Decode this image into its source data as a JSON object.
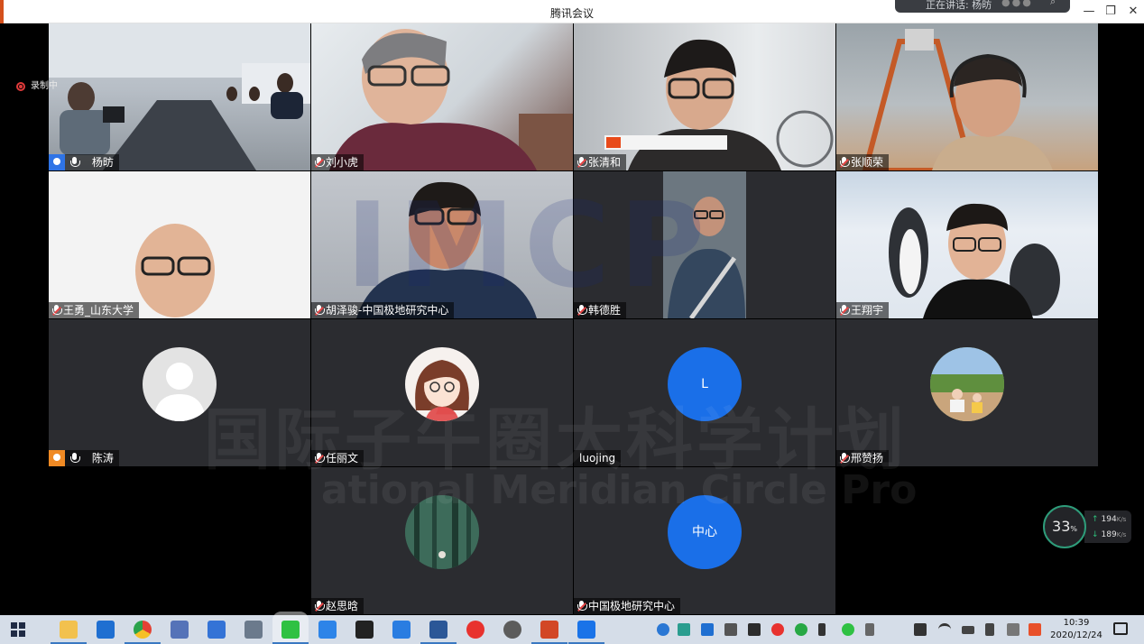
{
  "window": {
    "title": "腾讯会议",
    "speaking_label": "正在讲话: 杨昉",
    "minimize_glyph": "—",
    "restore_glyph": "❐",
    "close_glyph": "✕"
  },
  "recording": {
    "label": "录制中"
  },
  "participants": [
    {
      "name": "杨昉",
      "kind": "video"
    },
    {
      "name": "刘小虎",
      "kind": "video"
    },
    {
      "name": "张清和",
      "kind": "video"
    },
    {
      "name": "张顺荣",
      "kind": "video"
    },
    {
      "name": "王勇_山东大学",
      "kind": "video"
    },
    {
      "name": "胡泽骏-中国极地研究中心",
      "kind": "video"
    },
    {
      "name": "韩德胜",
      "kind": "video"
    },
    {
      "name": "王翔宇",
      "kind": "video"
    },
    {
      "name": "陈涛",
      "kind": "avatar"
    },
    {
      "name": "任丽文",
      "kind": "avatar"
    },
    {
      "name": "luojing",
      "kind": "initial",
      "initial": "L"
    },
    {
      "name": "邢赞扬",
      "kind": "avatar"
    },
    {
      "name": "赵思晗",
      "kind": "avatar"
    },
    {
      "name": "中国极地研究中心",
      "kind": "initial",
      "initial": "中心"
    }
  ],
  "watermark": {
    "line1": "国际子午圈大科学计划",
    "line2": "ational Meridian Circle Pro",
    "logo": "IMCP"
  },
  "network": {
    "cpu_percent": "33",
    "percent_sign": "%",
    "up_rate": "194",
    "down_rate": "189",
    "unit": "K/s"
  },
  "clock": {
    "time": "10:39",
    "date": "2020/12/24"
  }
}
